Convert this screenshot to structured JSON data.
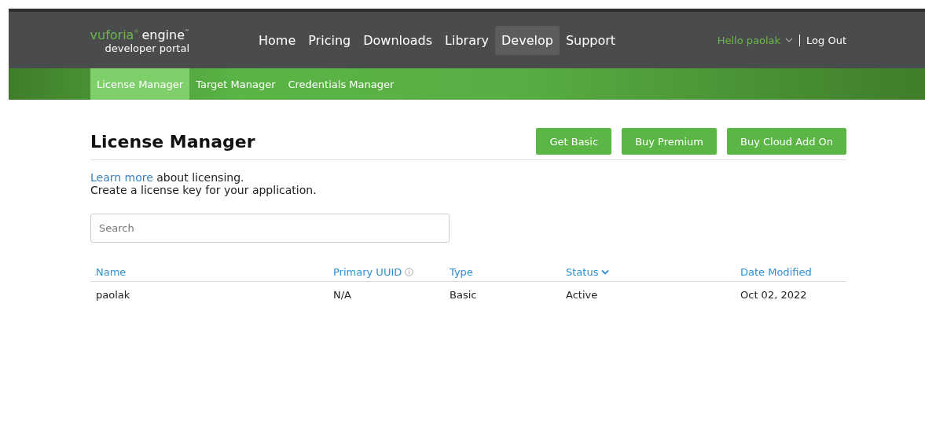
{
  "logo": {
    "brand": "vuforia",
    "brand_mark": "®",
    "product": "engine",
    "product_mark": "™",
    "tagline": "developer portal"
  },
  "nav": [
    {
      "label": "Home",
      "selected": false
    },
    {
      "label": "Pricing",
      "selected": false
    },
    {
      "label": "Downloads",
      "selected": false
    },
    {
      "label": "Library",
      "selected": false
    },
    {
      "label": "Develop",
      "selected": true
    },
    {
      "label": "Support",
      "selected": false
    }
  ],
  "user_menu": {
    "greeting": "Hello paolak",
    "logout": "Log Out"
  },
  "subnav": [
    {
      "label": "License Manager",
      "selected": true
    },
    {
      "label": "Target Manager",
      "selected": false
    },
    {
      "label": "Credentials Manager",
      "selected": false
    }
  ],
  "page_title": "License Manager",
  "actions": [
    "Get Basic",
    "Buy Premium",
    "Buy Cloud Add On"
  ],
  "intro": {
    "link": "Learn more",
    "text": " about licensing.",
    "line2": "Create a license key for your application."
  },
  "search": {
    "placeholder": "Search"
  },
  "table": {
    "columns": [
      {
        "label": "Name",
        "info": false,
        "sorted": false
      },
      {
        "label": "Primary UUID",
        "info": true,
        "sorted": false
      },
      {
        "label": "Type",
        "info": false,
        "sorted": false
      },
      {
        "label": "Status",
        "info": false,
        "sorted": true
      },
      {
        "label": "Date Modified",
        "info": false,
        "sorted": false
      }
    ],
    "rows": [
      [
        "paolak",
        "N/A",
        "Basic",
        "Active",
        "Oct 02, 2022"
      ]
    ]
  }
}
